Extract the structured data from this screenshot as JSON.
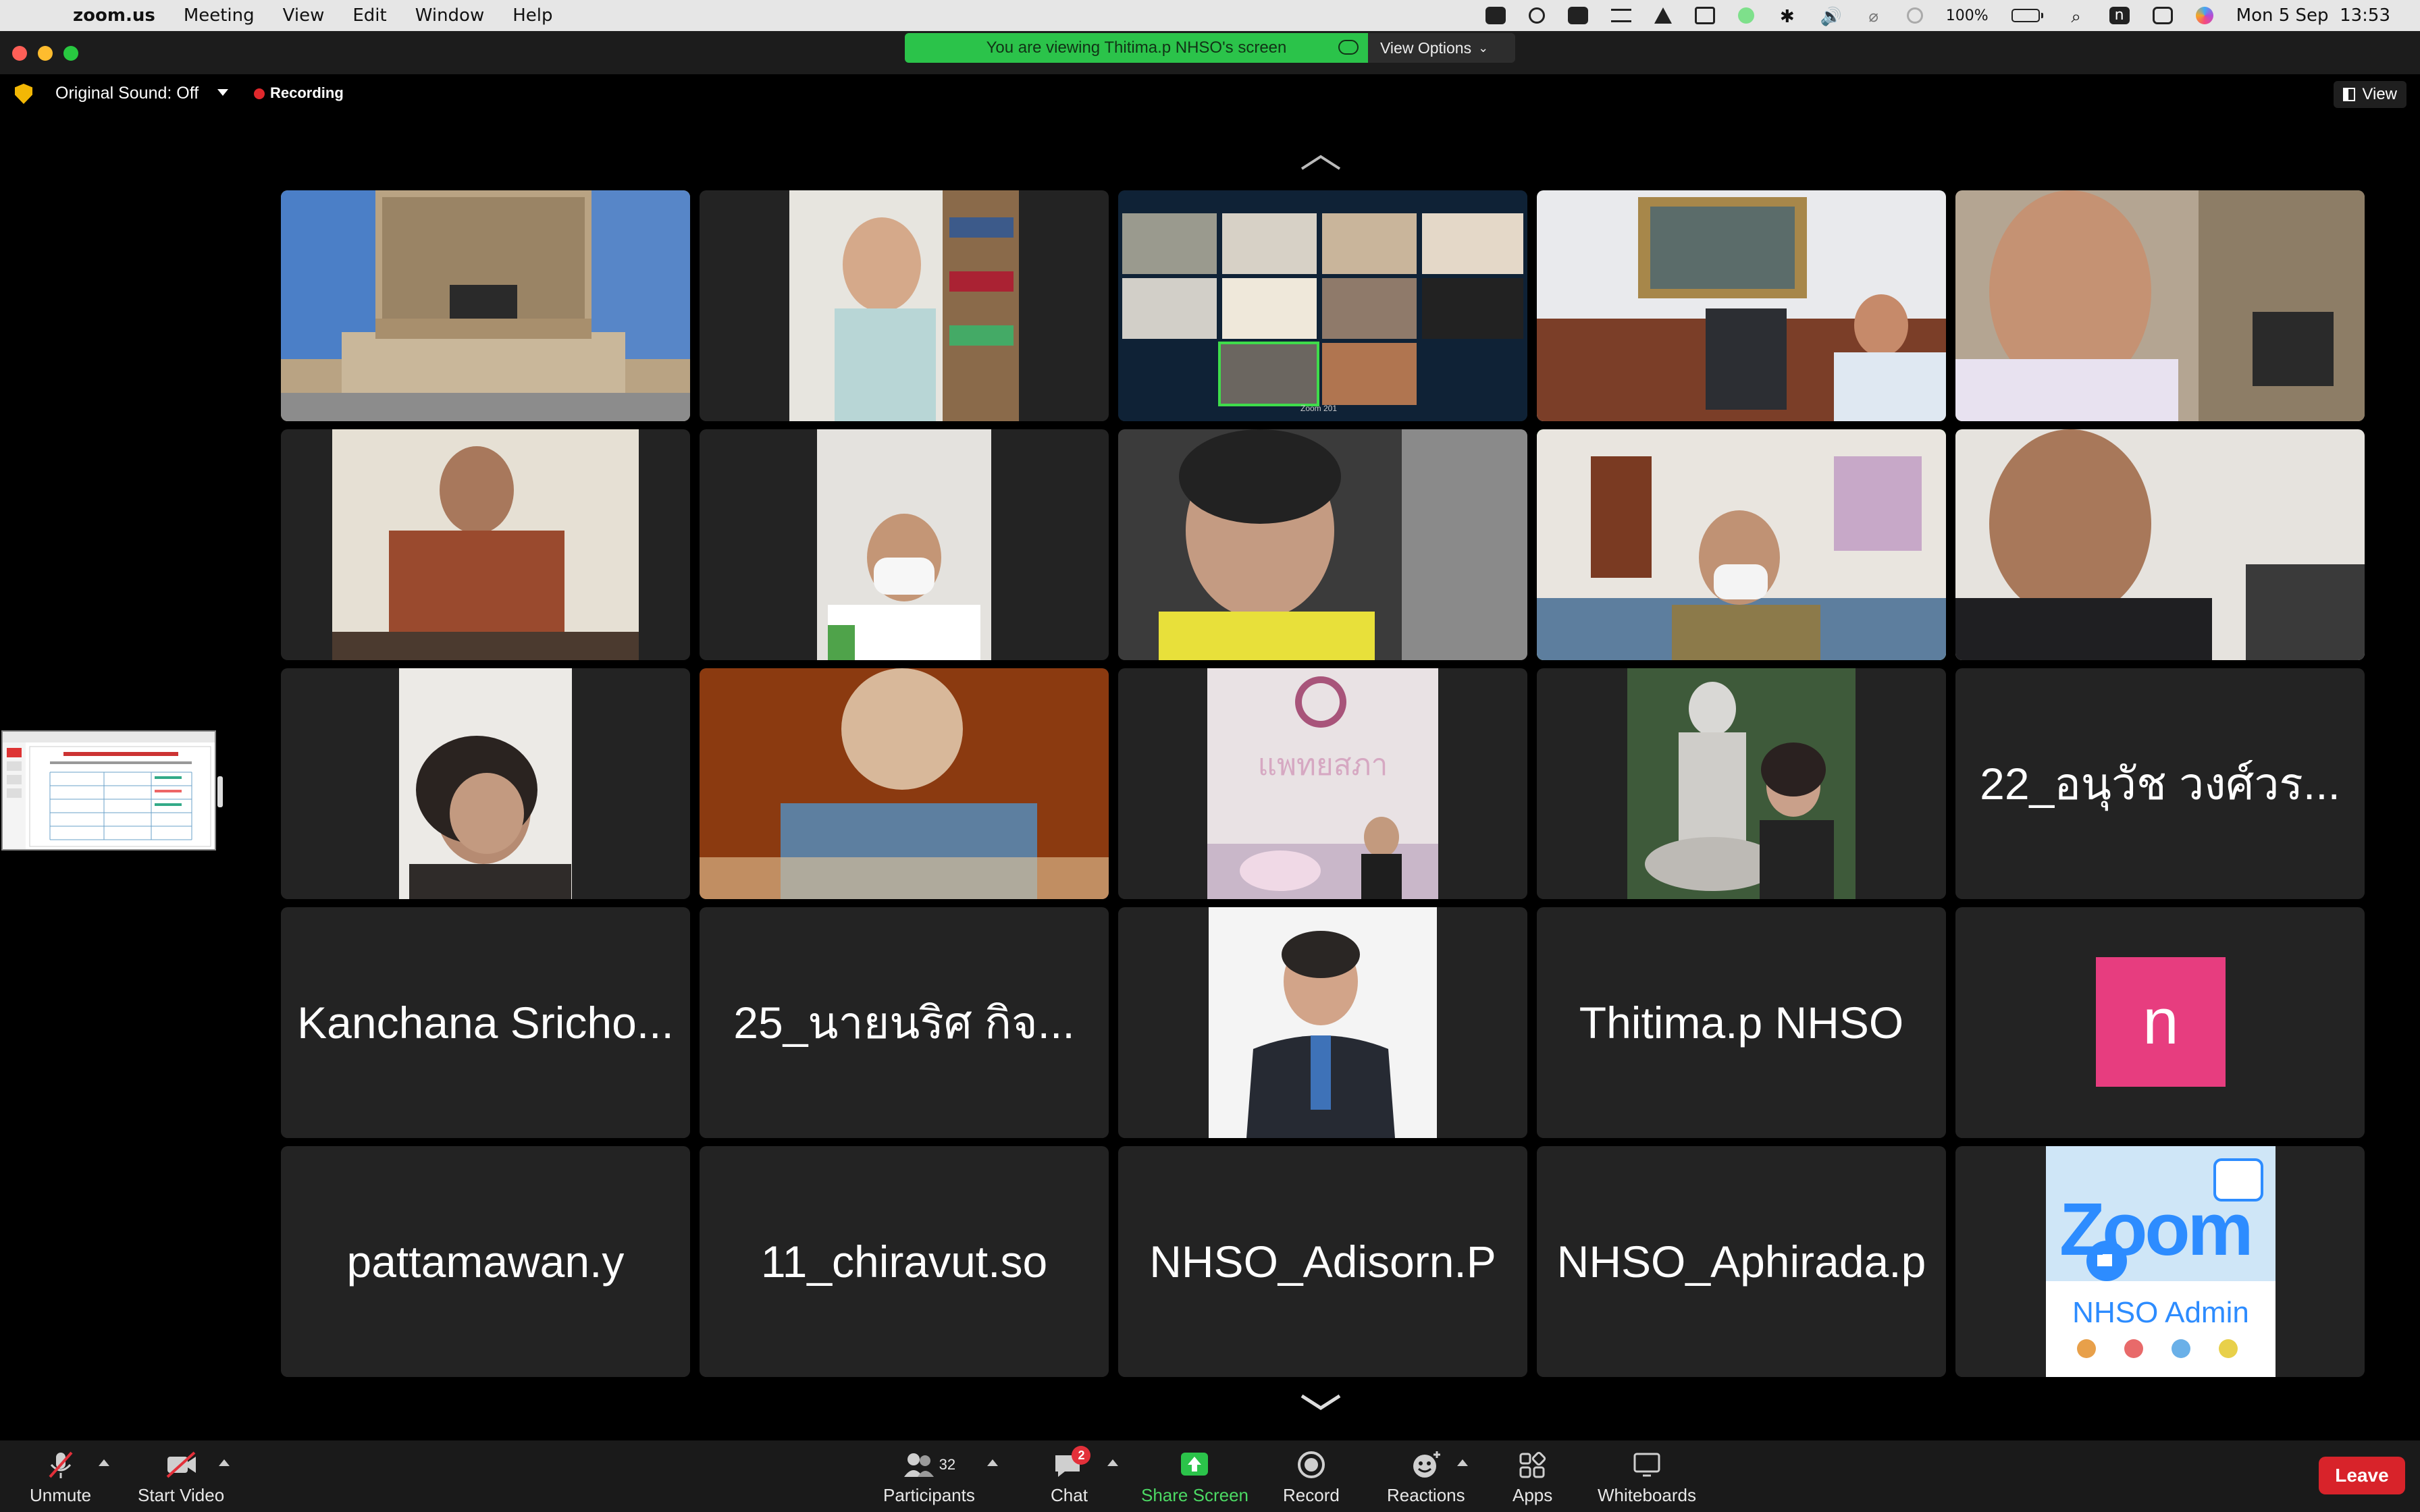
{
  "menubar": {
    "app_name": "zoom.us",
    "items": [
      "Meeting",
      "View",
      "Edit",
      "Window",
      "Help"
    ],
    "battery": "100%",
    "clock": "Mon 5 Sep  13:53"
  },
  "titlebar": {
    "share_banner": "You are viewing Thitima.p NHSO's screen",
    "view_options": "View Options"
  },
  "toprow": {
    "original_sound": "Original Sound: Off",
    "recording": "Recording",
    "view": "View"
  },
  "gallery": {
    "name_tiles": {
      "t15": "22_อนุวัช วงศ์วร...",
      "t16": "Kanchana Sricho...",
      "t17": "25_นายนริศ กิจ...",
      "t19": "Thitima.p NHSO",
      "t20_avatar": "n",
      "t21": "pattamawan.y",
      "t22": "11_chiravut.so",
      "t23": "NHSO_Adisorn.P",
      "t24": "NHSO_Aphirada.p"
    },
    "sign_text": "แพทยสภา",
    "zoom_logo_text": "Zoom 201",
    "admin_logo": {
      "word": "Zoom",
      "label": "NHSO Admin"
    }
  },
  "toolbar": {
    "unmute": "Unmute",
    "start_video": "Start Video",
    "participants": "Participants",
    "participants_count": "32",
    "chat": "Chat",
    "chat_badge": "2",
    "share_screen": "Share Screen",
    "record": "Record",
    "reactions": "Reactions",
    "apps": "Apps",
    "whiteboards": "Whiteboards",
    "leave": "Leave"
  },
  "colors": {
    "share_green": "#2bc34a",
    "active_border": "#3fdc4b",
    "leave_red": "#d8232a",
    "avatar_pink": "#e73d7f"
  }
}
